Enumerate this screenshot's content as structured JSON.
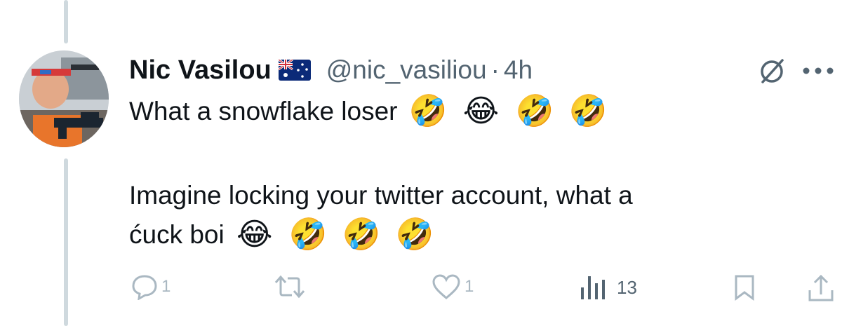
{
  "tweet": {
    "author_name": "Nic Vasilou",
    "handle": "@nic_vasiliou",
    "separator": "·",
    "time": "4h",
    "line1": "What a snowflake loser",
    "line1_emojis": [
      "🤣",
      "😂",
      "🤣",
      "🤣"
    ],
    "line2": "Imagine locking your twitter account, what a",
    "line3": "ćuck boi",
    "line3_emojis": [
      "😂",
      "🤣",
      "🤣",
      "🤣"
    ]
  },
  "actions": {
    "reply_count": "1",
    "like_count": "1",
    "views_count": "13"
  },
  "icons": {
    "flag": "australia-flag-icon",
    "mute": "muted-conversation-icon",
    "more": "more-options-icon",
    "reply": "reply-icon",
    "retweet": "retweet-icon",
    "like": "heart-icon",
    "views": "views-chart-icon",
    "bookmark": "bookmark-icon",
    "share": "share-icon"
  },
  "colors": {
    "text": "#0f1419",
    "secondary": "#536471",
    "faint_icon": "#aab8c2",
    "thread_line": "#cfd9de"
  }
}
